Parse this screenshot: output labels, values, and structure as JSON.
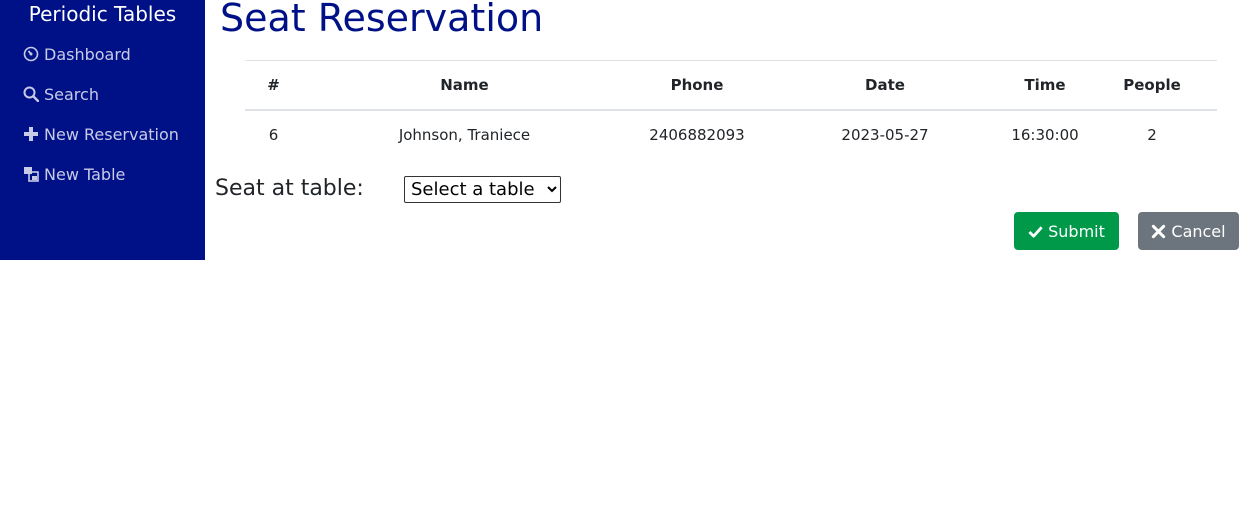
{
  "sidebar": {
    "brand": "Periodic Tables",
    "items": [
      {
        "label": "Dashboard",
        "icon": "dashboard-icon"
      },
      {
        "label": "Search",
        "icon": "search-icon"
      },
      {
        "label": "New Reservation",
        "icon": "plus-icon"
      },
      {
        "label": "New Table",
        "icon": "tables-icon"
      }
    ]
  },
  "page": {
    "title": "Seat Reservation"
  },
  "table": {
    "headers": [
      "#",
      "Name",
      "Phone",
      "Date",
      "Time",
      "People"
    ],
    "rows": [
      [
        "6",
        "Johnson, Traniece",
        "2406882093",
        "2023-05-27",
        "16:30:00",
        "2"
      ]
    ]
  },
  "form": {
    "seat_label": "Seat at table:",
    "select_value": "Select a table"
  },
  "buttons": {
    "submit": "Submit",
    "cancel": "Cancel"
  },
  "colors": {
    "sidebar_bg": "#001188",
    "title": "#001188",
    "submit_bg": "#00994a",
    "cancel_bg": "#6c757d"
  }
}
